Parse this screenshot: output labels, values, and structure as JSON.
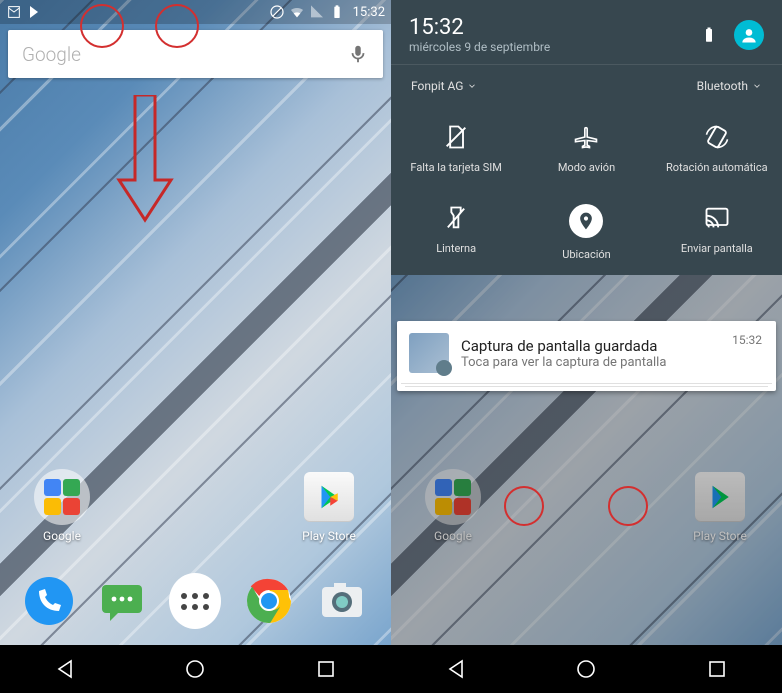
{
  "status": {
    "time": "15:32"
  },
  "search": {
    "placeholder": "Google"
  },
  "home": {
    "folder_label": "Google",
    "playstore_label": "Play Store"
  },
  "qs": {
    "time": "15:32",
    "date": "miércoles 9 de septiembre",
    "wifi_label": "Fonpit AG",
    "bt_label": "Bluetooth",
    "tiles": {
      "sim": "Falta la tarjeta SIM",
      "airplane": "Modo avión",
      "rotation": "Rotación automática",
      "flashlight": "Linterna",
      "location": "Ubicación",
      "cast": "Enviar pantalla"
    }
  },
  "notif": {
    "title": "Captura de pantalla guardada",
    "subtitle": "Toca para ver la captura de pantalla",
    "time": "15:32"
  },
  "right_home": {
    "google_label": "Google",
    "playstore_label": "Play Store"
  }
}
